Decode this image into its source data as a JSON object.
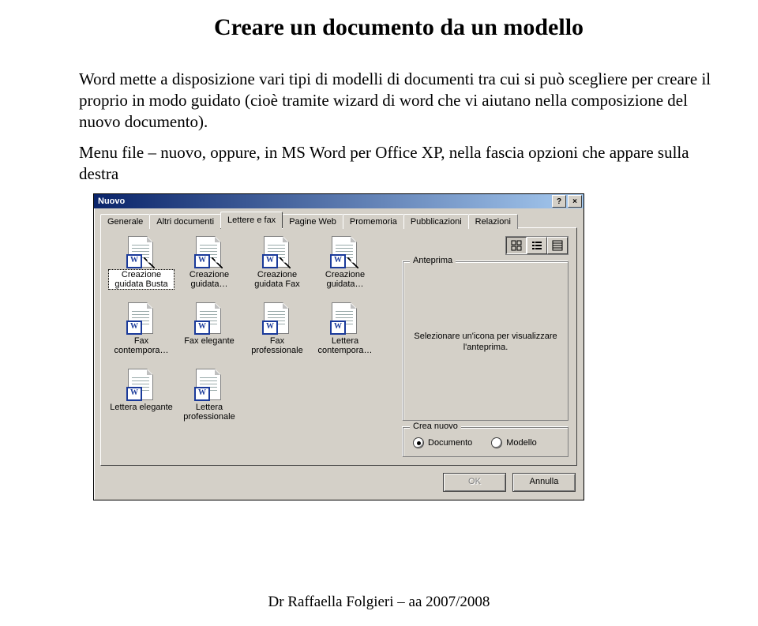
{
  "title": "Creare un documento da un modello",
  "paragraph1": "Word mette a disposizione vari tipi di modelli di documenti tra cui si può scegliere per creare il proprio in modo guidato (cioè tramite wizard di word che vi aiutano nella composizione del nuovo documento).",
  "paragraph2": "Menu file – nuovo, oppure, in MS Word per Office XP, nella fascia opzioni che appare sulla destra",
  "dialog": {
    "title": "Nuovo",
    "help_glyph": "?",
    "close_glyph": "×",
    "tabs": [
      "Generale",
      "Altri documenti",
      "Lettere e fax",
      "Pagine Web",
      "Promemoria",
      "Pubblicazioni",
      "Relazioni"
    ],
    "active_tab": 2,
    "items": [
      {
        "label": "Creazione guidata Busta",
        "wizard": true,
        "selected": true
      },
      {
        "label": "Creazione guidata…",
        "wizard": true
      },
      {
        "label": "Creazione guidata Fax",
        "wizard": true
      },
      {
        "label": "Creazione guidata…",
        "wizard": true
      },
      {
        "label": "Fax contempora…",
        "wizard": false
      },
      {
        "label": "Fax elegante",
        "wizard": false
      },
      {
        "label": "Fax professionale",
        "wizard": false
      },
      {
        "label": "Lettera contempora…",
        "wizard": false
      },
      {
        "label": "Lettera elegante",
        "wizard": false
      },
      {
        "label": "Lettera professionale",
        "wizard": false
      }
    ],
    "preview_group": "Anteprima",
    "preview_text": "Selezionare un'icona per visualizzare l'anteprima.",
    "create_group": "Crea nuovo",
    "radio_document": "Documento",
    "radio_template": "Modello",
    "ok": "OK",
    "cancel": "Annulla"
  },
  "footer": "Dr Raffaella Folgieri – aa 2007/2008"
}
